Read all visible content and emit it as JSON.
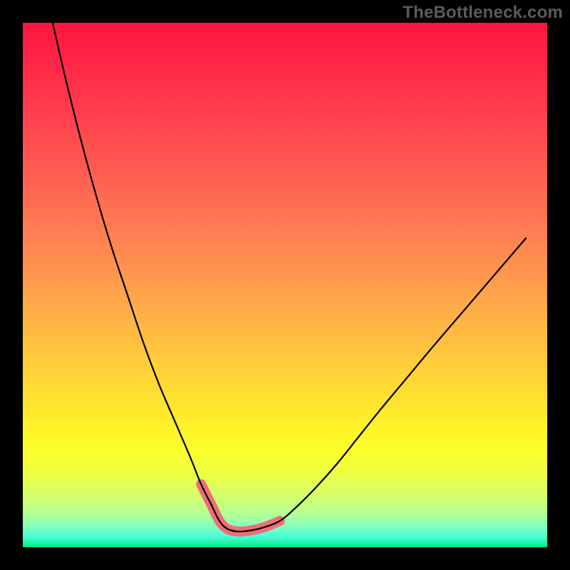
{
  "watermark": "TheBottleneck.com",
  "chart_data": {
    "type": "line",
    "title": "",
    "xlabel": "",
    "ylabel": "",
    "xlim": [
      0,
      100
    ],
    "ylim": [
      0,
      100
    ],
    "grid": false,
    "legend": false,
    "series": [
      {
        "name": "curve",
        "color": "#000000",
        "x": [
          5.7,
          8,
          11,
          14,
          17,
          20,
          23,
          26,
          29,
          32,
          34,
          36,
          37.5,
          39,
          41,
          43.5,
          46,
          49,
          52,
          56,
          60,
          64,
          68,
          73,
          78,
          84,
          90,
          96
        ],
        "y": [
          100,
          90,
          78,
          67,
          57,
          48,
          39,
          31,
          24,
          17,
          12,
          8,
          5,
          3.5,
          3,
          3.2,
          3.8,
          5,
          7.5,
          11.5,
          16,
          21,
          26,
          32,
          38,
          45,
          52,
          59
        ]
      },
      {
        "name": "highlight-segment",
        "color": "#ef6d78",
        "stroke_width_px": 14,
        "linecap": "round",
        "x": [
          34,
          36,
          37.5,
          39,
          41,
          43.5,
          46,
          49
        ],
        "y": [
          12,
          8,
          5,
          3.5,
          3,
          3.2,
          3.8,
          5
        ]
      }
    ],
    "background_gradient": {
      "stops": [
        {
          "offset": 0.0,
          "color": "#ff153f"
        },
        {
          "offset": 0.08,
          "color": "#ff2746"
        },
        {
          "offset": 0.16,
          "color": "#ff3b4c"
        },
        {
          "offset": 0.24,
          "color": "#ff5150"
        },
        {
          "offset": 0.32,
          "color": "#ff6753"
        },
        {
          "offset": 0.4,
          "color": "#ff7e52"
        },
        {
          "offset": 0.48,
          "color": "#ff974e"
        },
        {
          "offset": 0.56,
          "color": "#ffb146"
        },
        {
          "offset": 0.64,
          "color": "#ffca3b"
        },
        {
          "offset": 0.72,
          "color": "#ffe22f"
        },
        {
          "offset": 0.78,
          "color": "#fff629"
        },
        {
          "offset": 0.82,
          "color": "#fbff2d"
        },
        {
          "offset": 0.86,
          "color": "#ecff44"
        },
        {
          "offset": 0.9,
          "color": "#d6ff68"
        },
        {
          "offset": 0.935,
          "color": "#b6ff93"
        },
        {
          "offset": 0.96,
          "color": "#84ffbc"
        },
        {
          "offset": 0.98,
          "color": "#47ffd8"
        },
        {
          "offset": 1.0,
          "color": "#00e97f"
        }
      ]
    }
  }
}
